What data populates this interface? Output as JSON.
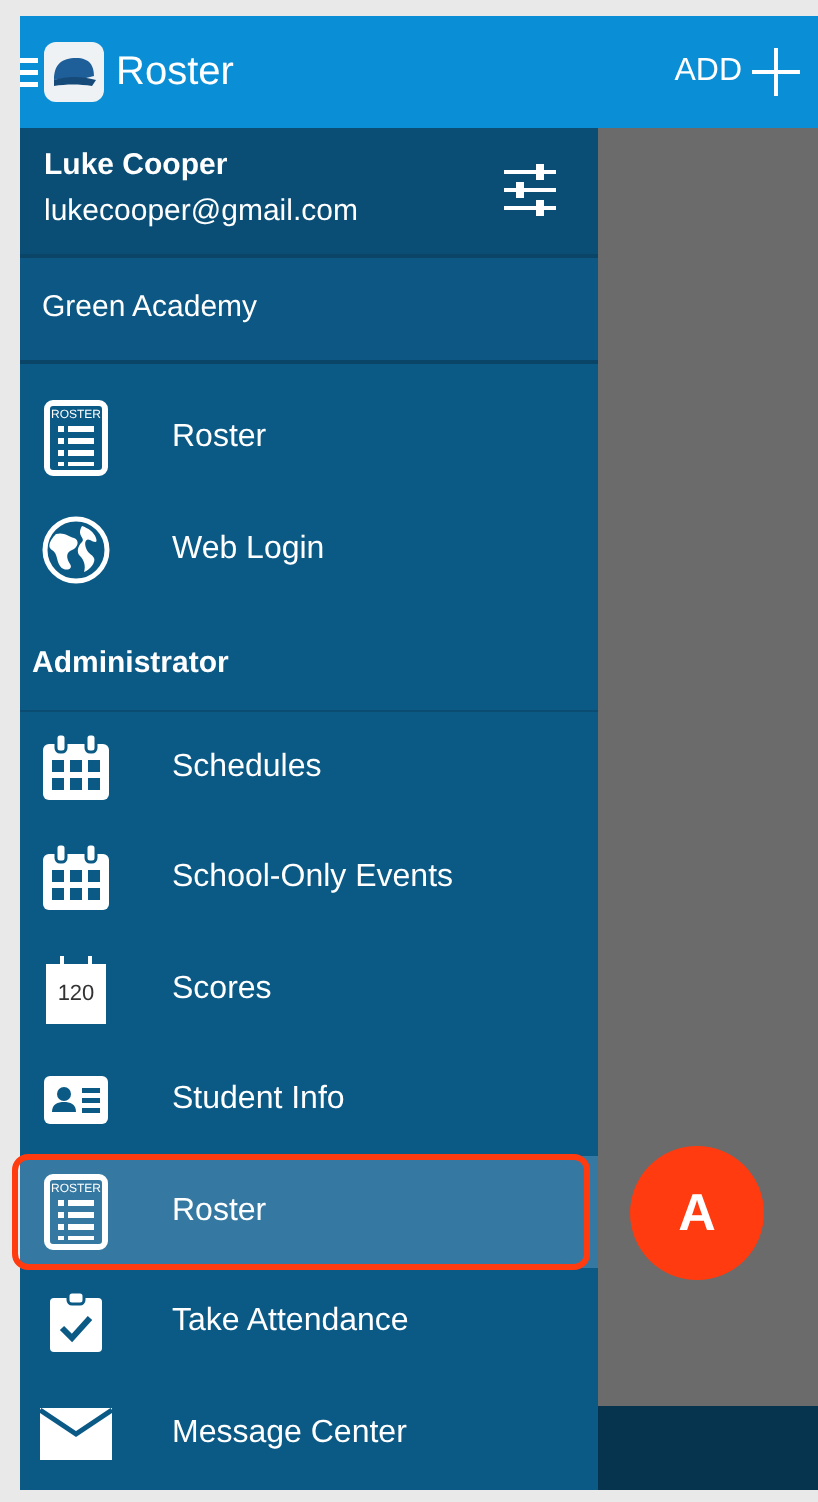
{
  "app_bar": {
    "title": "Roster",
    "action": "ADD"
  },
  "account": {
    "name": "Luke Cooper",
    "email": "lukecooper@gmail.com"
  },
  "school": "Green Academy",
  "sections": [
    {
      "items": [
        {
          "kind": "roster",
          "icon_text": "ROSTER",
          "label": "Roster",
          "selected": false
        },
        {
          "kind": "globe",
          "label": "Web Login",
          "selected": false
        }
      ]
    },
    {
      "header": "Administrator",
      "items": [
        {
          "kind": "calendar",
          "label": "Schedules",
          "selected": false
        },
        {
          "kind": "calendar",
          "label": "School-Only Events",
          "selected": false
        },
        {
          "kind": "scores",
          "icon_text": "120",
          "label": "Scores",
          "selected": false
        },
        {
          "kind": "idcard",
          "label": "Student Info",
          "selected": false
        },
        {
          "kind": "roster",
          "icon_text": "ROSTER",
          "label": "Roster",
          "selected": true
        },
        {
          "kind": "clipboard",
          "label": "Take Attendance",
          "selected": false
        },
        {
          "kind": "envelope",
          "label": "Message Center",
          "selected": false
        }
      ]
    }
  ],
  "callout": {
    "label": "A"
  }
}
